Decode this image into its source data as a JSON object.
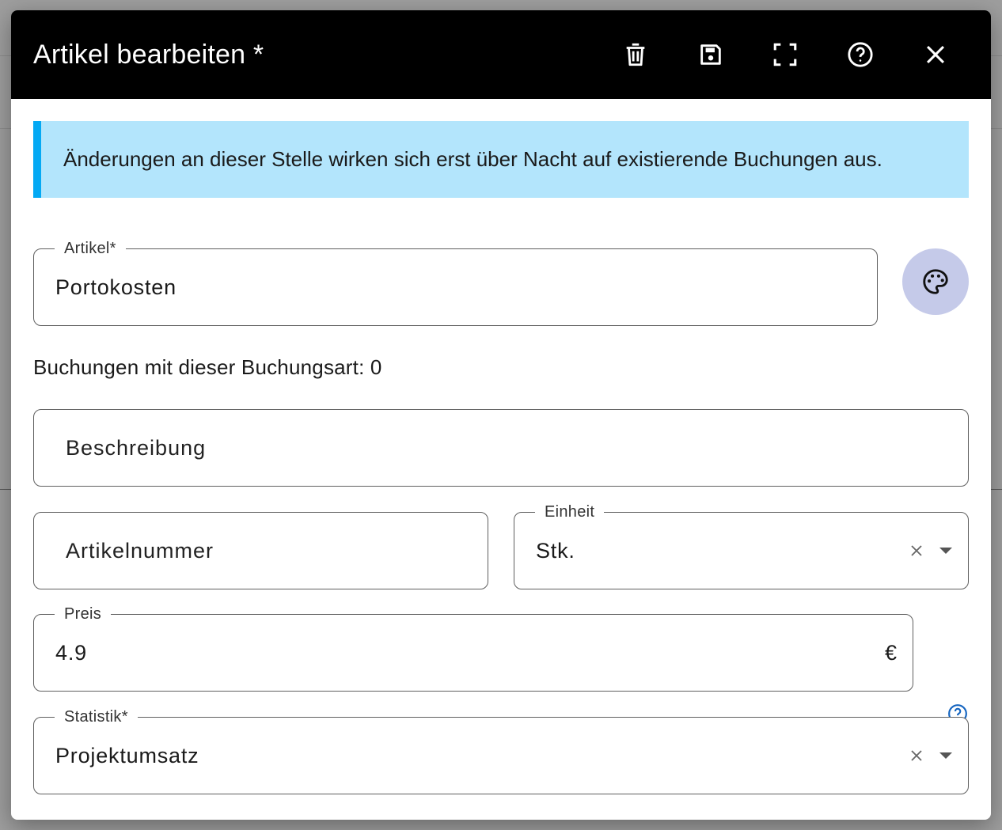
{
  "dialog": {
    "title": "Artikel bearbeiten *",
    "toolbar": {
      "delete_icon": "trash-icon",
      "save_icon": "save-icon",
      "fullscreen_icon": "fullscreen-icon",
      "help_icon": "help-icon",
      "close_icon": "close-icon"
    }
  },
  "info": {
    "text": "Änderungen an dieser Stelle wirken sich erst über Nacht auf existierende Buchungen aus.",
    "accent_color": "#03a9f4",
    "background_color": "#b3e5fc"
  },
  "form": {
    "artikel": {
      "label": "Artikel*",
      "value": "Portokosten"
    },
    "color_button": {
      "icon": "palette-icon",
      "color": "#c5cae9"
    },
    "bookings_text": "Buchungen mit dieser Buchungsart: 0",
    "beschreibung": {
      "placeholder": "Beschreibung"
    },
    "artikelnummer": {
      "placeholder": "Artikelnummer"
    },
    "einheit": {
      "label": "Einheit",
      "value": "Stk."
    },
    "preis": {
      "label": "Preis",
      "value": "4.9",
      "suffix": "€"
    },
    "statistik": {
      "label": "Statistik*",
      "value": "Projektumsatz"
    }
  }
}
